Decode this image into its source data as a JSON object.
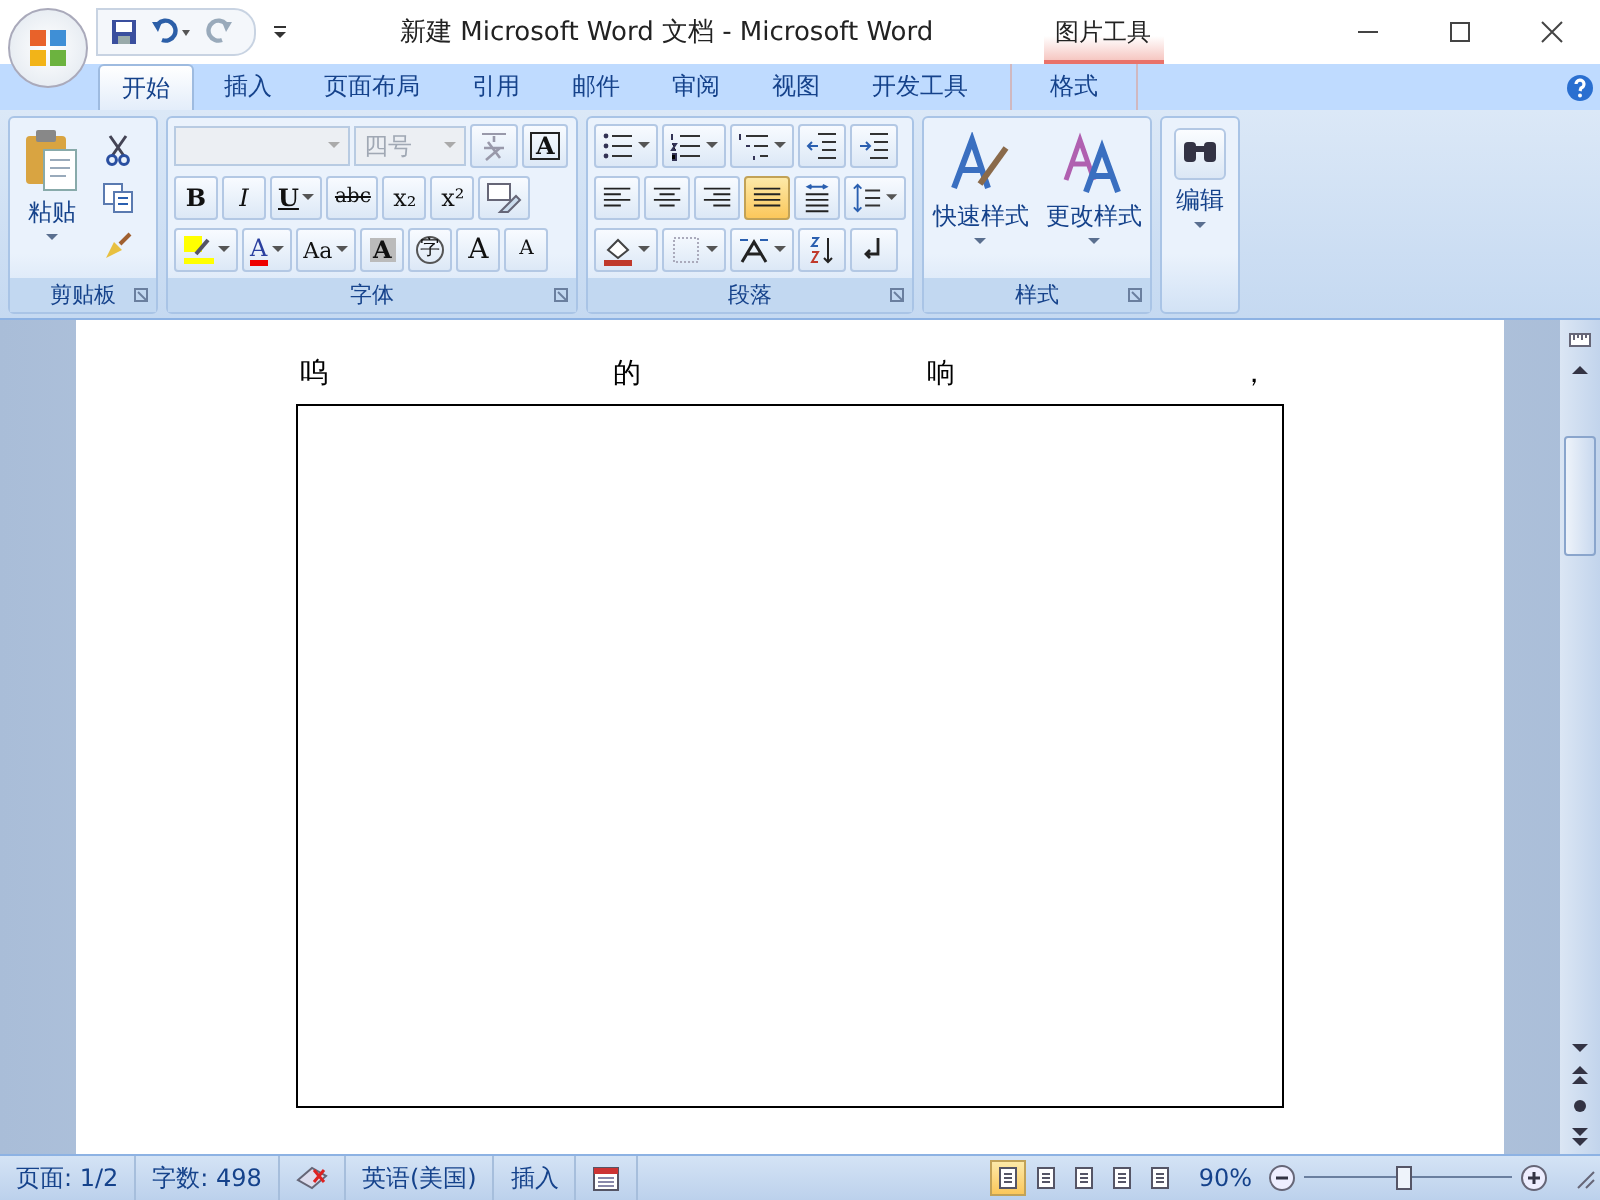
{
  "window": {
    "title": "新建 Microsoft Word 文档 - Microsoft Word",
    "context_group": "图片工具"
  },
  "tabs": [
    {
      "label": "开始",
      "selected": true,
      "kind": "normal"
    },
    {
      "label": "插入",
      "selected": false,
      "kind": "normal"
    },
    {
      "label": "页面布局",
      "selected": false,
      "kind": "normal"
    },
    {
      "label": "引用",
      "selected": false,
      "kind": "normal"
    },
    {
      "label": "邮件",
      "selected": false,
      "kind": "normal"
    },
    {
      "label": "审阅",
      "selected": false,
      "kind": "normal"
    },
    {
      "label": "视图",
      "selected": false,
      "kind": "normal"
    },
    {
      "label": "开发工具",
      "selected": false,
      "kind": "normal"
    },
    {
      "label": "格式",
      "selected": false,
      "kind": "context"
    }
  ],
  "clipboard": {
    "paste": "粘贴",
    "label": "剪贴板"
  },
  "font": {
    "label": "字体",
    "size": "四号",
    "disabled": true,
    "rows": [
      [
        {
          "kind": "phonetic",
          "dropdown": false
        },
        {
          "kind": "boxed",
          "label": "A",
          "dropdown": false
        }
      ],
      [
        {
          "kind": "bold",
          "label": "B",
          "dropdown": false
        },
        {
          "kind": "italic",
          "label": "I",
          "dropdown": false
        },
        {
          "kind": "underline",
          "label": "U",
          "dropdown": true
        },
        {
          "kind": "strike",
          "label": "abc",
          "dropdown": false
        },
        {
          "kind": "sub",
          "label": "x₂",
          "dropdown": false
        },
        {
          "kind": "sup",
          "label": "x²",
          "dropdown": false
        },
        {
          "kind": "clear",
          "dropdown": false
        }
      ],
      [
        {
          "kind": "highlight",
          "dropdown": true
        },
        {
          "kind": "color",
          "label": "A",
          "dropdown": true
        },
        {
          "kind": "case",
          "label": "Aa",
          "dropdown": true
        },
        {
          "kind": "shaded",
          "label": "A",
          "dropdown": false
        },
        {
          "kind": "enclosed",
          "label": "字",
          "dropdown": false
        },
        {
          "kind": "grow",
          "label": "A",
          "dropdown": false
        },
        {
          "kind": "shrink",
          "label": "A",
          "dropdown": false
        }
      ]
    ]
  },
  "paragraph": {
    "label": "段落",
    "rows": [
      [
        {
          "kind": "bullets",
          "dropdown": true,
          "selected": false
        },
        {
          "kind": "numbering",
          "dropdown": true,
          "selected": false
        },
        {
          "kind": "multilevel",
          "dropdown": true,
          "selected": false
        },
        {
          "kind": "outdent",
          "dropdown": false,
          "selected": false
        },
        {
          "kind": "indent",
          "dropdown": false,
          "selected": false
        }
      ],
      [
        {
          "kind": "align-left",
          "dropdown": false,
          "selected": false
        },
        {
          "kind": "align-center",
          "dropdown": false,
          "selected": false
        },
        {
          "kind": "align-right",
          "dropdown": false,
          "selected": false
        },
        {
          "kind": "justify",
          "dropdown": false,
          "selected": true
        },
        {
          "kind": "distribute",
          "dropdown": false,
          "selected": false
        },
        {
          "kind": "spacing",
          "dropdown": true,
          "selected": false
        }
      ],
      [
        {
          "kind": "shading",
          "dropdown": true,
          "selected": false
        },
        {
          "kind": "border",
          "dropdown": true,
          "selected": false
        },
        {
          "kind": "asian",
          "dropdown": true,
          "selected": false
        },
        {
          "kind": "sort",
          "dropdown": false,
          "selected": false
        },
        {
          "kind": "marks",
          "dropdown": false,
          "selected": false
        }
      ]
    ]
  },
  "styles": {
    "label": "样式",
    "buttons": [
      {
        "label": "快速样式",
        "kind": "quick"
      },
      {
        "label": "更改样式",
        "kind": "change"
      }
    ]
  },
  "editing": {
    "label": "编辑"
  },
  "document": {
    "line": [
      "呜",
      "的",
      "响",
      "，"
    ]
  },
  "status_bar": {
    "page": "页面: 1/2",
    "words": "字数: 498",
    "language": "英语(美国)",
    "mode": "插入",
    "zoom": "90%",
    "zoom_level": {
      "level": 0.48
    },
    "views": [
      {
        "selected": true
      },
      {
        "selected": false
      },
      {
        "selected": false
      },
      {
        "selected": false
      },
      {
        "selected": false
      }
    ]
  }
}
